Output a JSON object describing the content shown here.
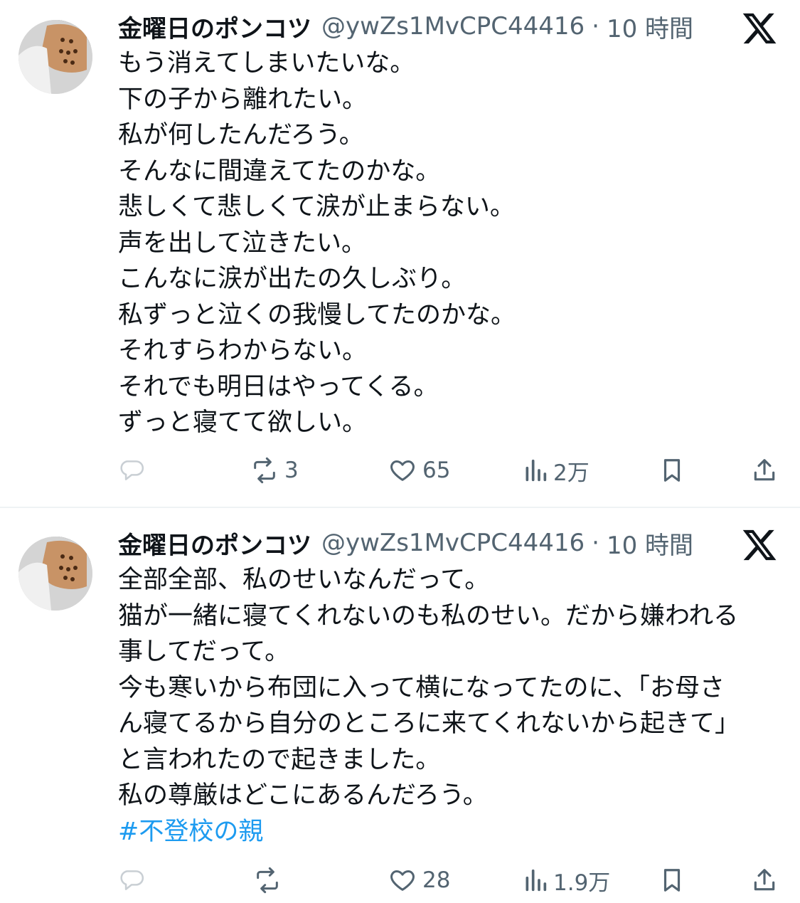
{
  "tweets": [
    {
      "author": {
        "name": "金曜日のポンコツ",
        "handle": "@ywZs1MvCPC44416",
        "separator": "·",
        "time": "10 時間"
      },
      "lines": [
        "もう消えてしまいたいな。",
        "下の子から離れたい。",
        "私が何したんだろう。",
        "そんなに間違えてたのかな。",
        "悲しくて悲しくて涙が止まらない。",
        "声を出して泣きたい。",
        "こんなに涙が出たの久しぶり。",
        "私ずっと泣くの我慢してたのかな。",
        "それすらわからない。",
        "それでも明日はやってくる。",
        "ずっと寝てて欲しい。"
      ],
      "hashtag": "",
      "stats": {
        "replies": "",
        "reposts": "3",
        "likes": "65",
        "views": "2万"
      }
    },
    {
      "author": {
        "name": "金曜日のポンコツ",
        "handle": "@ywZs1MvCPC44416",
        "separator": "·",
        "time": "10 時間"
      },
      "lines": [
        "全部全部、私のせいなんだって。",
        "猫が一緒に寝てくれないのも私のせい。だから嫌われる",
        "事してだって。",
        "今も寒いから布団に入って横になってたのに、「お母さ",
        "ん寝てるから自分のところに来てくれないから起きて」",
        "と言われたので起きました。",
        "私の尊厳はどこにあるんだろう。"
      ],
      "hashtag": "#不登校の親",
      "stats": {
        "replies": "",
        "reposts": "",
        "likes": "28",
        "views": "1.9万"
      }
    }
  ],
  "icons": {
    "reply": "reply-icon",
    "repost": "repost-icon",
    "like": "heart-icon",
    "views": "views-icon",
    "bookmark": "bookmark-icon",
    "share": "share-icon",
    "platform": "x-logo-icon"
  },
  "colors": {
    "text": "#0f1419",
    "secondary": "#536471",
    "link": "#1d9bf0",
    "divider": "#eff3f4"
  }
}
